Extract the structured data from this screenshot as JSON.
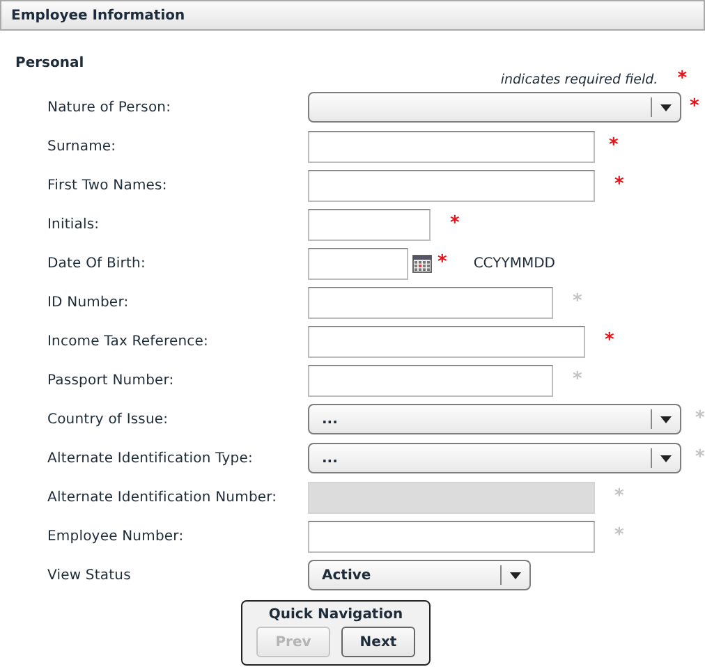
{
  "panel": {
    "title": "Employee Information"
  },
  "section": {
    "title": "Personal",
    "required_note": "indicates required field.",
    "required_mark": "*"
  },
  "fields": [
    {
      "label": "Nature of Person:",
      "kind": "select",
      "required": true,
      "disabled": false
    },
    {
      "label": "Surname:",
      "kind": "text",
      "required": true,
      "disabled": false
    },
    {
      "label": "First Two Names:",
      "kind": "text",
      "required": true,
      "disabled": false
    },
    {
      "label": "Initials:",
      "kind": "text",
      "required": true,
      "disabled": false
    },
    {
      "label": "Date Of Birth:",
      "kind": "date",
      "required": true,
      "disabled": false,
      "format_hint": "CCYYMMDD"
    },
    {
      "label": "ID Number:",
      "kind": "text",
      "required": false,
      "disabled": false
    },
    {
      "label": "Income Tax Reference:",
      "kind": "text",
      "required": true,
      "disabled": false
    },
    {
      "label": "Passport Number:",
      "kind": "text",
      "required": false,
      "disabled": false
    },
    {
      "label": "Country of Issue:",
      "kind": "select",
      "value": "...",
      "required": false,
      "disabled": false
    },
    {
      "label": "Alternate Identification Type:",
      "kind": "select",
      "value": "...",
      "required": false,
      "disabled": false
    },
    {
      "label": "Alternate Identification Number:",
      "kind": "text",
      "required": false,
      "disabled": true
    },
    {
      "label": "Employee Number:",
      "kind": "text",
      "required": false,
      "disabled": false
    },
    {
      "label": "View Status",
      "kind": "select",
      "value": "Active",
      "disabled": false
    }
  ],
  "quick_navigation": {
    "title": "Quick Navigation",
    "buttons": [
      {
        "label": "Prev",
        "disabled": true
      },
      {
        "label": "Next",
        "disabled": false
      }
    ]
  }
}
